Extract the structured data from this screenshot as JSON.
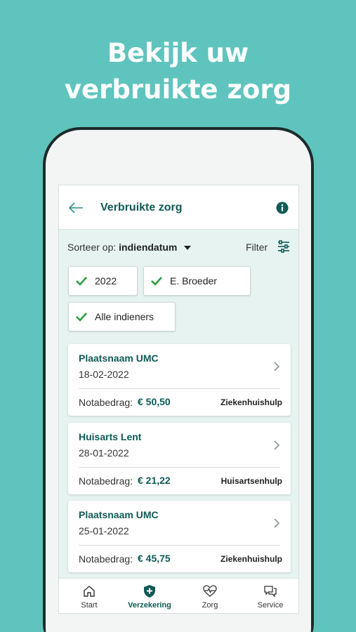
{
  "headline": [
    "Bekijk uw",
    "verbruikte zorg"
  ],
  "appbar": {
    "title": "Verbruikte zorg"
  },
  "sort": {
    "label": "Sorteer op:",
    "value": "indiendatum"
  },
  "filter": {
    "label": "Filter"
  },
  "chips": [
    {
      "label": "2022"
    },
    {
      "label": "E. Broeder"
    },
    {
      "label": "Alle indieners"
    }
  ],
  "amount_label": "Notabedrag:",
  "cards": [
    {
      "title": "Plaatsnaam UMC",
      "date": "18-02-2022",
      "amount": "€ 50,50",
      "type": "Ziekenhuishulp"
    },
    {
      "title": "Huisarts Lent",
      "date": "28-01-2022",
      "amount": "€ 21,22",
      "type": "Huisartsenhulp"
    },
    {
      "title": "Plaatsnaam UMC",
      "date": "25-01-2022",
      "amount": "€ 45,75",
      "type": "Ziekenhuishulp"
    }
  ],
  "nav": [
    {
      "label": "Start",
      "icon": "home-icon"
    },
    {
      "label": "Verzekering",
      "icon": "shield-plus-icon",
      "active": true
    },
    {
      "label": "Zorg",
      "icon": "heartbeat-icon"
    },
    {
      "label": "Service",
      "icon": "chat-icon"
    }
  ],
  "colors": {
    "background": "#5fc4bd",
    "brand": "#0f5a55",
    "check": "#2e9d3f"
  }
}
